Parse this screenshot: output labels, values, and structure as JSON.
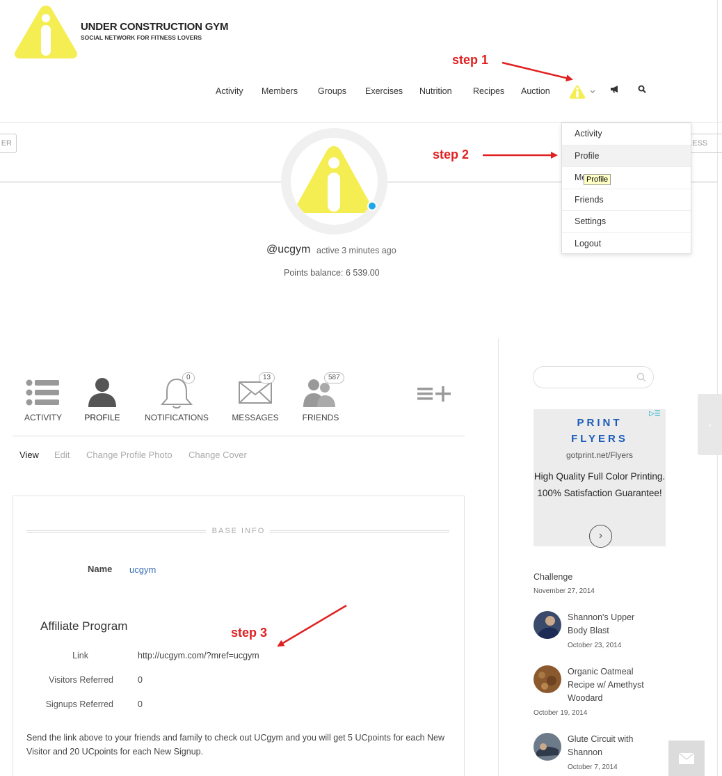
{
  "brand": {
    "title": "UNDER CONSTRUCTION GYM",
    "subtitle": "SOCIAL NETWORK FOR FITNESS LOVERS",
    "logo_color": "#f4ee53"
  },
  "nav": {
    "items": [
      "Activity",
      "Members",
      "Groups",
      "Exercises",
      "Nutrition",
      "Recipes",
      "Auction"
    ],
    "user_icon": "warning-logo-icon",
    "chevron_icon": "chevron-down-icon",
    "announce_icon": "megaphone-icon",
    "search_icon": "search-icon"
  },
  "steps": {
    "step1": "step 1",
    "step2": "step 2",
    "step3": "step 3",
    "color": "#e02020"
  },
  "dropdown": {
    "items": [
      "Activity",
      "Profile",
      "Me",
      "Friends",
      "Settings",
      "Logout"
    ],
    "active": "Profile",
    "tooltip": "Profile"
  },
  "cover": {
    "left_button": "ER",
    "right_button": "LESS"
  },
  "profile": {
    "handle": "@ucgym",
    "active": "active 3 minutes ago",
    "points": "Points balance: 6 539.00",
    "online_color": "#1ea7e8"
  },
  "tabs": [
    {
      "label": "ACTIVITY",
      "icon": "list-icon",
      "count": ""
    },
    {
      "label": "PROFILE",
      "icon": "person-icon",
      "count": ""
    },
    {
      "label": "NOTIFICATIONS",
      "icon": "bell-icon",
      "count": "0"
    },
    {
      "label": "MESSAGES",
      "icon": "envelope-icon",
      "count": "13"
    },
    {
      "label": "FRIENDS",
      "icon": "friends-icon",
      "count": "587"
    }
  ],
  "more_icon": "menu-plus-icon",
  "subnav": [
    "View",
    "Edit",
    "Change Profile Photo",
    "Change Cover"
  ],
  "base_info": {
    "title": "BASE INFO",
    "name_label": "Name",
    "name_value": "ucgym"
  },
  "affiliate": {
    "title": "Affiliate Program",
    "rows": [
      {
        "label": "Link",
        "value": "http://ucgym.com/?mref=ucgym"
      },
      {
        "label": "Visitors Referred",
        "value": "0"
      },
      {
        "label": "Signups Referred",
        "value": "0"
      }
    ],
    "note": "Send the link above to your friends and family to check out UCgym and you will get 5 UCpoints for each New Visitor and 20 UCpoints for each New Signup."
  },
  "ad": {
    "headline_1": "PRINT",
    "headline_2": "FLYERS",
    "url": "gotprint.net/Flyers",
    "body": "High Quality Full Color Printing. 100% Satisfaction Guarantee!",
    "badge": "▷☰"
  },
  "sidebar": {
    "first_post": {
      "title": "Challenge",
      "date": "November 27, 2014"
    },
    "posts": [
      {
        "title": "Shannon's Upper Body Blast",
        "date": "October 23, 2014"
      },
      {
        "title": "Organic Oatmeal Recipe w/ Amethyst Woodard",
        "date": "October 19, 2014"
      },
      {
        "title": "Glute Circuit with Shannon",
        "date": "October 7, 2014"
      }
    ],
    "side_tab_icon": "chevron-right-icon",
    "message_icon": "envelope-icon"
  }
}
